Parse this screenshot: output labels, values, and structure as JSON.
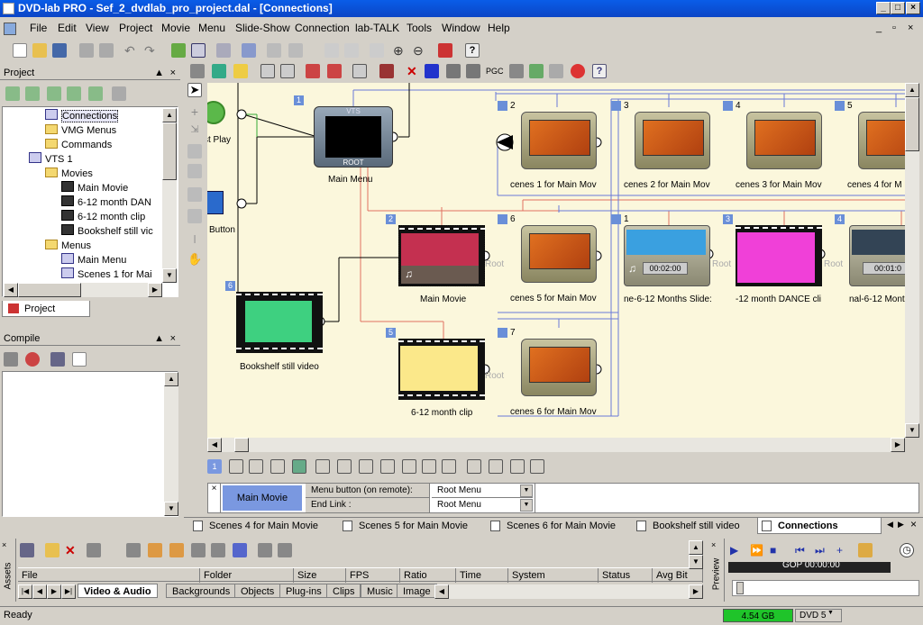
{
  "window": {
    "title": "DVD-lab PRO - Sef_2_dvdlab_pro_project.dal - [Connections]"
  },
  "menubar": [
    "File",
    "Edit",
    "View",
    "Project",
    "Movie",
    "Menu",
    "Slide-Show",
    "Connection",
    "lab-TALK",
    "Tools",
    "Window",
    "Help"
  ],
  "project_panel": {
    "title": "Project",
    "tab": "Project",
    "tree": [
      {
        "label": "Connections",
        "indent": 2,
        "icon": "connections-icon"
      },
      {
        "label": "VMG Menus",
        "indent": 2,
        "icon": "folder-icon"
      },
      {
        "label": "Commands",
        "indent": 2,
        "icon": "folder-icon"
      },
      {
        "label": "VTS 1",
        "indent": 1,
        "icon": "disc-icon"
      },
      {
        "label": "Movies",
        "indent": 2,
        "icon": "folder-icon"
      },
      {
        "label": "Main Movie",
        "indent": 3,
        "icon": "film-icon"
      },
      {
        "label": "6-12 month DAN",
        "indent": 3,
        "icon": "film-icon"
      },
      {
        "label": "6-12 month clip",
        "indent": 3,
        "icon": "film-icon"
      },
      {
        "label": "Bookshelf still vic",
        "indent": 3,
        "icon": "film-icon"
      },
      {
        "label": "Menus",
        "indent": 2,
        "icon": "folder-icon"
      },
      {
        "label": "Main Menu",
        "indent": 3,
        "icon": "menu-icon"
      },
      {
        "label": "Scenes 1 for Mai",
        "indent": 3,
        "icon": "menu-icon"
      }
    ]
  },
  "compile_panel": {
    "title": "Compile"
  },
  "canvas": {
    "first_play_label": "st Play",
    "button_label": "Button",
    "nodes": [
      {
        "num": "1",
        "label": "Main Menu",
        "badge": "VTS",
        "sub": "ROOT"
      },
      {
        "num": "2",
        "label": "Main Movie"
      },
      {
        "num": "6",
        "label": "Bookshelf still video"
      },
      {
        "num": "5",
        "label": "6-12 month clip"
      },
      {
        "num": "2",
        "label": "cenes 1 for Main Mov"
      },
      {
        "num": "3",
        "label": "cenes 2 for Main Mov"
      },
      {
        "num": "4",
        "label": "cenes 3 for Main Mov"
      },
      {
        "num": "5",
        "label": "cenes 4 for M"
      },
      {
        "num": "6",
        "label": "cenes 5 for Main Mov"
      },
      {
        "num": "7",
        "label": "cenes 6 for Main Mov"
      },
      {
        "num": "1",
        "label": "ne-6-12 Months Slide:",
        "time": "00:02:00"
      },
      {
        "num": "3",
        "label": "-12 month DANCE cli"
      },
      {
        "num": "4",
        "label": "nal-6-12 Month Scen",
        "time": "00:01:0"
      }
    ],
    "root_label": "Root"
  },
  "props": {
    "name": "Main Movie",
    "rows": [
      {
        "label": "Menu button (on remote):",
        "value": "Root Menu"
      },
      {
        "label": "End Link :",
        "value": "Root Menu"
      }
    ]
  },
  "doc_tabs": [
    "Scenes 4 for Main Movie",
    "Scenes 5 for Main Movie",
    "Scenes 6 for Main Movie",
    "Bookshelf still video",
    "Connections"
  ],
  "assets": {
    "side_label": "Assets",
    "columns": [
      "File",
      "Folder",
      "Size",
      "FPS",
      "Ratio",
      "Time",
      "System",
      "Status",
      "Avg Bit"
    ],
    "tabs": [
      "Video & Audio",
      "Backgrounds",
      "Objects",
      "Plug-ins",
      "Clips",
      "Music",
      "Image"
    ]
  },
  "preview": {
    "side_label": "Preview",
    "timecode": "GOP 00:00:00"
  },
  "status": {
    "text": "Ready",
    "size": "4.54 GB",
    "disc": "DVD 5"
  }
}
